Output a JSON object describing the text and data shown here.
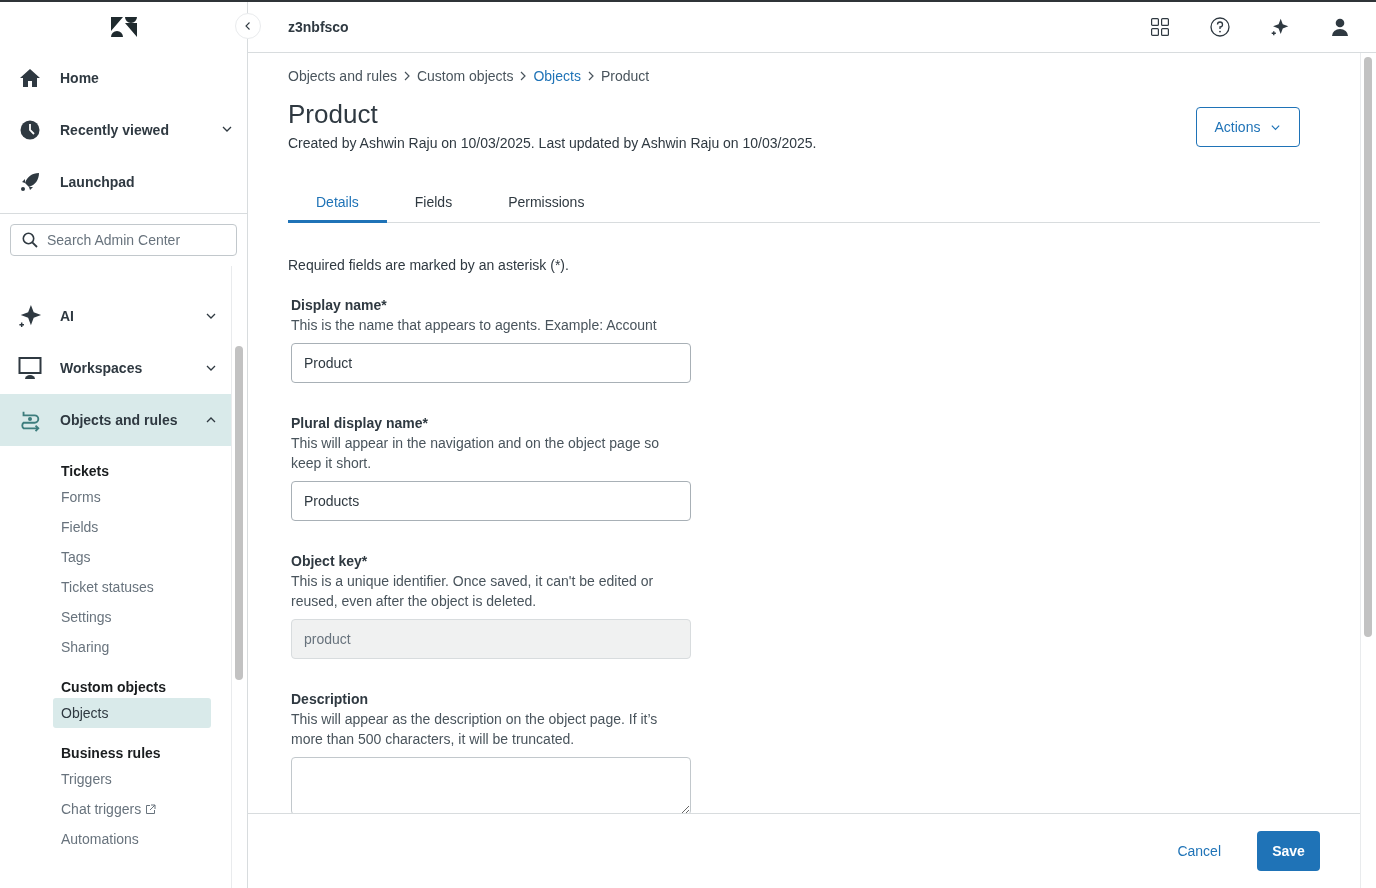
{
  "sidebar": {
    "nav": [
      {
        "label": "Home",
        "kind": "link"
      },
      {
        "label": "Recently viewed",
        "kind": "menu",
        "expanded": false
      },
      {
        "label": "Launchpad",
        "kind": "link"
      }
    ],
    "search": {
      "placeholder": "Search Admin Center"
    },
    "sections": [
      {
        "label": "AI",
        "expanded": false,
        "selected": false
      },
      {
        "label": "Workspaces",
        "expanded": false,
        "selected": false
      },
      {
        "label": "Objects and rules",
        "expanded": true,
        "selected": true
      }
    ],
    "groups": [
      {
        "title": "Tickets",
        "items": [
          {
            "label": "Forms",
            "selected": false,
            "external": false
          },
          {
            "label": "Fields",
            "selected": false,
            "external": false
          },
          {
            "label": "Tags",
            "selected": false,
            "external": false
          },
          {
            "label": "Ticket statuses",
            "selected": false,
            "external": false
          },
          {
            "label": "Settings",
            "selected": false,
            "external": false
          },
          {
            "label": "Sharing",
            "selected": false,
            "external": false
          }
        ]
      },
      {
        "title": "Custom objects",
        "items": [
          {
            "label": "Objects",
            "selected": true,
            "external": false
          }
        ]
      },
      {
        "title": "Business rules",
        "items": [
          {
            "label": "Triggers",
            "selected": false,
            "external": false
          },
          {
            "label": "Chat triggers",
            "selected": false,
            "external": true
          },
          {
            "label": "Automations",
            "selected": false,
            "external": false
          }
        ]
      }
    ]
  },
  "header": {
    "title": "z3nbfsco"
  },
  "breadcrumb": [
    {
      "label": "Objects and rules",
      "link": false
    },
    {
      "label": "Custom objects",
      "link": false
    },
    {
      "label": "Objects",
      "link": true
    },
    {
      "label": "Product",
      "link": false
    }
  ],
  "page": {
    "title": "Product",
    "meta": "Created by Ashwin Raju on 10/03/2025. Last updated by Ashwin Raju on 10/03/2025.",
    "actions": "Actions"
  },
  "tabs": [
    {
      "label": "Details",
      "selected": true
    },
    {
      "label": "Fields",
      "selected": false
    },
    {
      "label": "Permissions",
      "selected": false
    }
  ],
  "required_note": "Required fields are marked by an asterisk (*).",
  "fields": [
    {
      "kind": "input",
      "label": "Display name*",
      "hint": "This is the name that appears to agents. Example: Account",
      "value": "Product",
      "disabled": false
    },
    {
      "kind": "input",
      "label": "Plural display name*",
      "hint": "This will appear in the navigation and on the object page so keep it short.",
      "value": "Products",
      "disabled": false
    },
    {
      "kind": "input",
      "label": "Object key*",
      "hint": "This is a unique identifier. Once saved, it can't be edited or reused, even after the object is deleted.",
      "value": "product",
      "disabled": true
    },
    {
      "kind": "textarea",
      "label": "Description",
      "hint": "This will appear as the description on the object page. If it’s more than 500 characters, it will be truncated."
    }
  ],
  "footer": {
    "cancel": "Cancel",
    "save": "Save"
  }
}
